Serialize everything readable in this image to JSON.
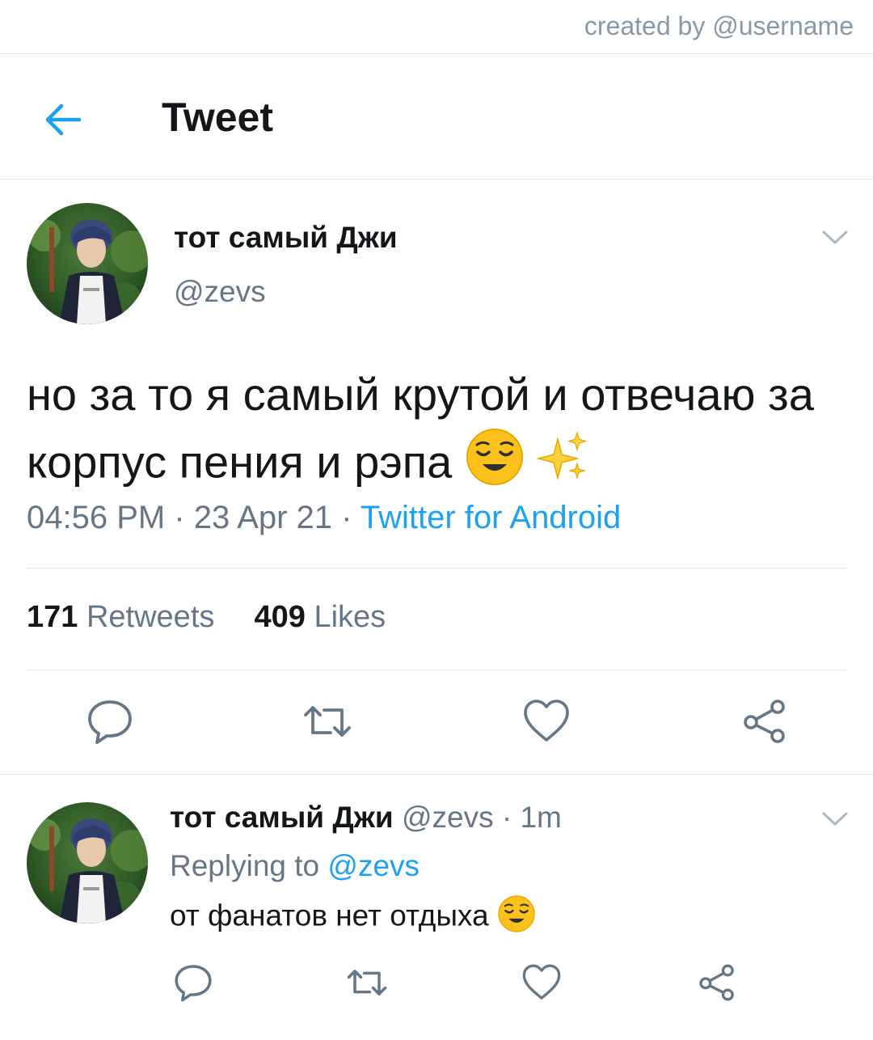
{
  "credit": "created by @username",
  "header": {
    "title": "Tweet",
    "back_icon": "arrow-left-icon"
  },
  "tweet": {
    "display_name": "тот самый Джи",
    "handle": "@zevs",
    "text": "но за то я самый крутой и отвечаю за корпус пения и рэпа",
    "emojis": [
      "relieved-face-emoji",
      "sparkles-emoji"
    ],
    "time": "04:56 PM",
    "separator": "·",
    "date": "23 Apr 21",
    "source": "Twitter for Android",
    "retweets_count": "171",
    "retweets_label": "Retweets",
    "likes_count": "409",
    "likes_label": "Likes",
    "actions": [
      "reply-icon",
      "retweet-icon",
      "heart-icon",
      "share-icon"
    ]
  },
  "reply": {
    "display_name": "тот самый Джи",
    "handle": "@zevs",
    "separator": "·",
    "time": "1m",
    "replying_label": "Replying to",
    "replying_to": "@zevs",
    "text": "от фанатов нет отдыха",
    "emoji": "relieved-face-emoji"
  },
  "colors": {
    "accent": "#1da1f2",
    "secondary_text": "#657786",
    "divider": "#e1e8ed",
    "icon_gray": "#657786"
  }
}
